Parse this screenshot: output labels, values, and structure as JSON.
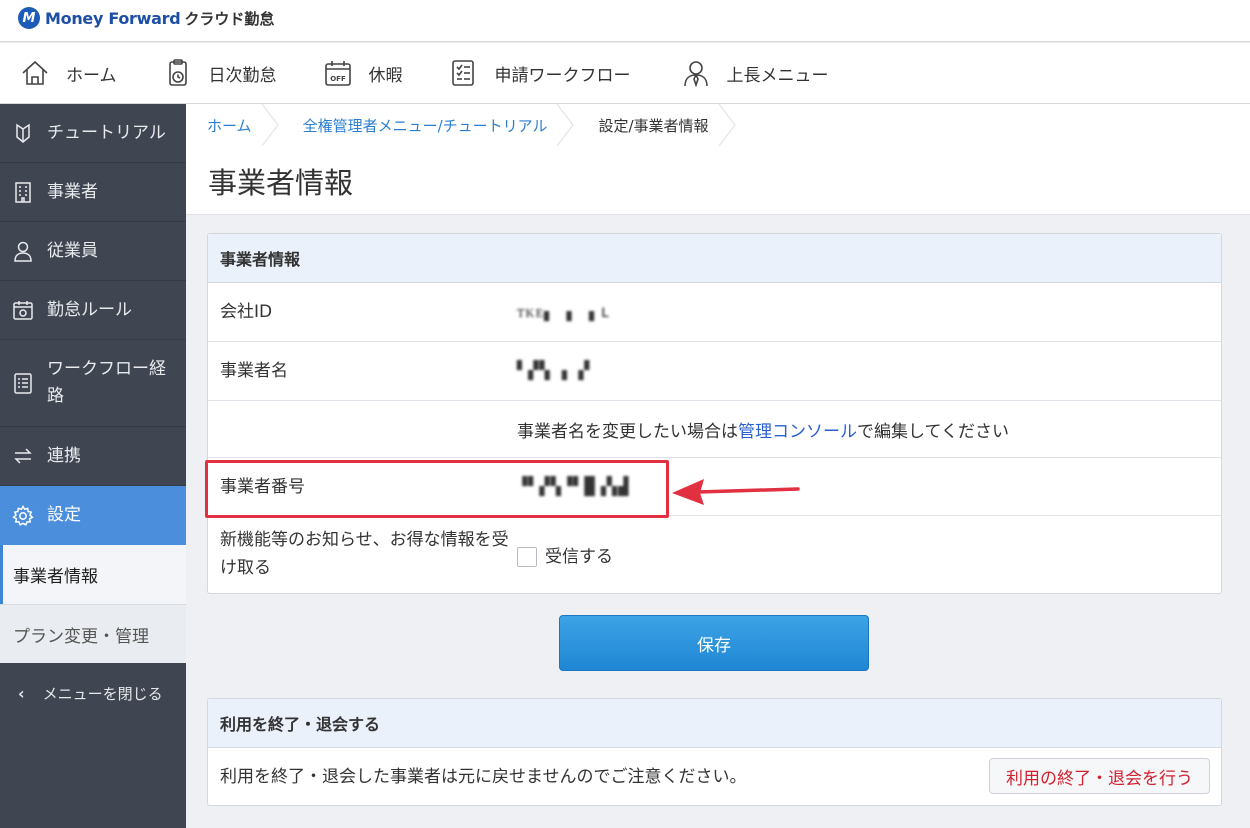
{
  "header": {
    "brand": "Money Forward",
    "product": "クラウド勤怠"
  },
  "globalnav": [
    {
      "label": "ホーム",
      "icon": "home-icon"
    },
    {
      "label": "日次勤怠",
      "icon": "clipboard-clock-icon"
    },
    {
      "label": "休暇",
      "icon": "calendar-off-icon"
    },
    {
      "label": "申請ワークフロー",
      "icon": "checklist-icon"
    },
    {
      "label": "上長メニュー",
      "icon": "manager-icon"
    }
  ],
  "sidebar": {
    "items": [
      {
        "label": "チュートリアル",
        "icon": "beginner-mark-icon"
      },
      {
        "label": "事業者",
        "icon": "building-icon"
      },
      {
        "label": "従業員",
        "icon": "person-icon"
      },
      {
        "label": "勤怠ルール",
        "icon": "calendar-gear-icon"
      },
      {
        "label": "ワークフロー経路",
        "icon": "list-icon"
      },
      {
        "label": "連携",
        "icon": "swap-icon"
      },
      {
        "label": "設定",
        "icon": "gear-icon"
      }
    ],
    "sub_items": [
      "事業者情報",
      "プラン変更・管理"
    ],
    "close_menu": "メニューを閉じる"
  },
  "breadcrumb": [
    "ホーム",
    "全権管理者メニュー/チュートリアル",
    "設定/事業者情報"
  ],
  "page_title": "事業者情報",
  "company_panel": {
    "heading": "事業者情報",
    "company_id_label": "会社ID",
    "company_id_value": "ᴛᴋᴇ▖ ▖ ▖ʟ",
    "company_name_label": "事業者名",
    "company_name_value": "▘▞▚ ▖▗▘",
    "note_prefix": "事業者名を変更したい場合は",
    "note_link": "管理コンソール",
    "note_suffix": "で編集してください",
    "company_number_label": "事業者番号",
    "company_number_value": "▝▘▞▚▝▘█▗▚▟",
    "newsletter_label": "新機能等のお知らせ、お得な情報を受け取る",
    "newsletter_checkbox_label": "受信する",
    "newsletter_checked": false
  },
  "save_button": "保存",
  "withdraw_panel": {
    "heading": "利用を終了・退会する",
    "text": "利用を終了・退会した事業者は元に戻せませんのでご注意ください。",
    "button": "利用の終了・退会を行う"
  },
  "colors": {
    "accent": "#4b8fdc",
    "sidebar": "#3f4651",
    "danger": "#d1202f",
    "annotation": "#e1303f"
  }
}
